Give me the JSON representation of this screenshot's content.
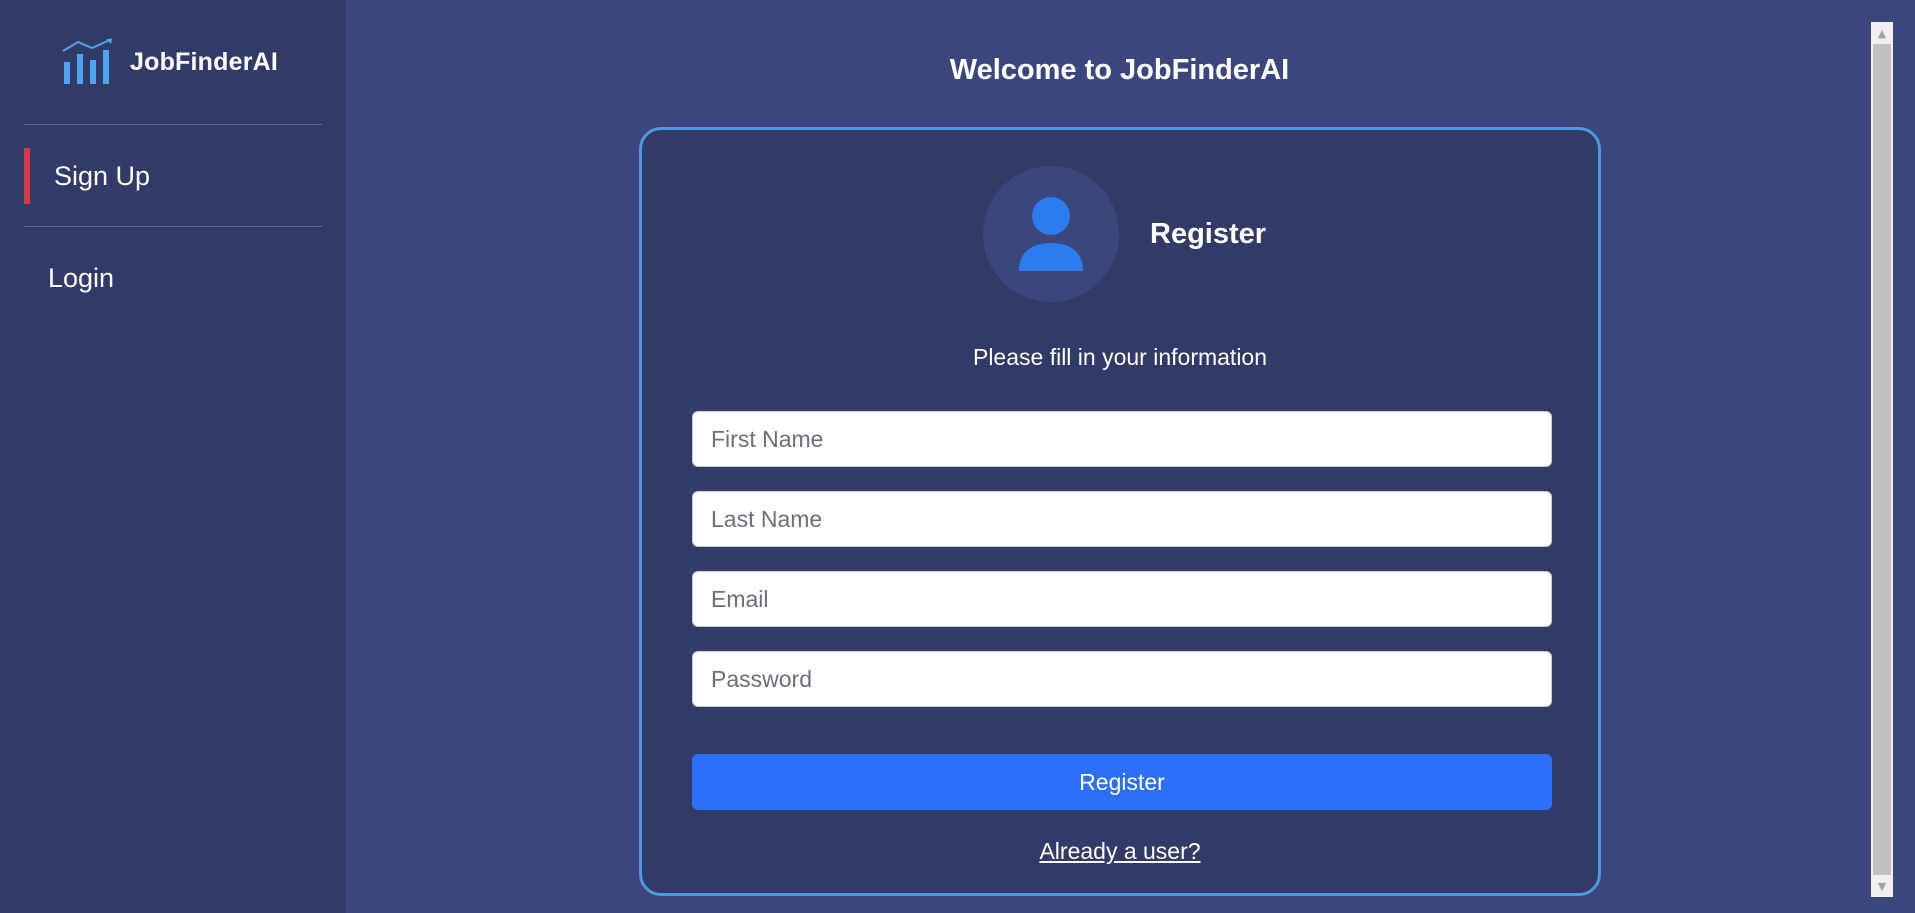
{
  "brand": {
    "name": "JobFinderAI",
    "accent_color": "#4ea6ee"
  },
  "sidebar": {
    "items": [
      {
        "label": "Sign Up",
        "active": true
      },
      {
        "label": "Login",
        "active": false
      }
    ],
    "active_indicator_color": "#d33a4a"
  },
  "main": {
    "title": "Welcome to JobFinderAI"
  },
  "card": {
    "title": "Register",
    "subtitle": "Please fill in your information",
    "avatar_icon": "user-icon",
    "fields": {
      "first_name": {
        "placeholder": "First Name",
        "value": ""
      },
      "last_name": {
        "placeholder": "Last Name",
        "value": ""
      },
      "email": {
        "placeholder": "Email",
        "value": ""
      },
      "password": {
        "placeholder": "Password",
        "value": ""
      }
    },
    "submit_label": "Register",
    "login_link": "Already a user?",
    "border_color": "#4c9ae0",
    "button_color": "#2b6ffb"
  }
}
